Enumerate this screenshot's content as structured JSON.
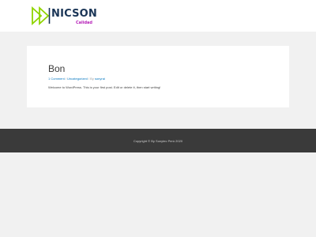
{
  "header": {
    "logo_name": "NICSON",
    "logo_tagline": "Calidad"
  },
  "post": {
    "title": "Bon",
    "meta": {
      "comments": "1 Comment",
      "separator_1": " / ",
      "category": "Uncategorized",
      "separator_2": " / By ",
      "author": "sonyrai"
    },
    "content": "Welcome to WordPress. This is your first post. Edit or delete it, then start writing!"
  },
  "footer": {
    "copyright": "Copyright © By Sonytec Perú 2020"
  },
  "colors": {
    "page_background": "#f1f1f1",
    "footer_background": "#3a3a3a",
    "link": "#0274be",
    "logo_green": "#8fd400",
    "logo_navy": "#1a3556",
    "logo_magenta": "#b620b8"
  }
}
